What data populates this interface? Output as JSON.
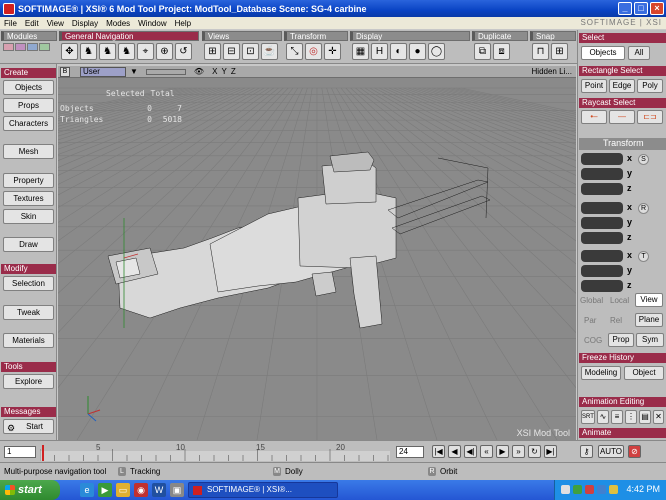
{
  "title": {
    "app": "SOFTIMAGE®",
    "text": "SOFTIMAGE® | XSI® 6 Mod Tool Project: ModTool_Database    Scene: SG-4 carbine",
    "brand": "SOFTIMAGE | XSI"
  },
  "menu": [
    "File",
    "Edit",
    "View",
    "Display",
    "Modes",
    "Window",
    "Help"
  ],
  "toolbar": {
    "modules": "Modules",
    "general_navigation": "General Navigation",
    "views": "Views",
    "transform": "Transform",
    "display": "Display",
    "duplicate": "Duplicate",
    "snap": "Snap",
    "select": "Select",
    "logo_text": "SOFTIMAGE | XSI"
  },
  "left_panel": {
    "create_header": "Create",
    "buttons_create": [
      "Objects",
      "Props",
      "Characters",
      "Mesh",
      "Property",
      "Textures",
      "Skin",
      "Draw"
    ],
    "modify_header": "Modify",
    "buttons_modify": [
      "Selection",
      "Tweak",
      "Materials"
    ],
    "tools_header": "Tools",
    "buttons_tools": [
      "Explore"
    ],
    "messages_header": "Messages",
    "start_label": "Start"
  },
  "viewport": {
    "letter": "B",
    "camera": "User",
    "xyz": "X Y Z",
    "hidden": "Hidden Li...",
    "stats_header": [
      "Selected",
      "Total"
    ],
    "stats": [
      {
        "label": "Objects",
        "selected": "0",
        "total": "7"
      },
      {
        "label": "Triangles",
        "selected": "0",
        "total": "5018"
      }
    ],
    "footer": "XSI Mod Tool"
  },
  "right_panel": {
    "select_header": "Select",
    "objects": "Objects",
    "all": "All",
    "rect_select": "Rectangle Select",
    "point": "Point",
    "edge": "Edge",
    "poly": "Poly",
    "raycast_select": "Raycast Select",
    "transform": "Transform",
    "axes": [
      "x",
      "y",
      "z",
      "x",
      "y",
      "z",
      "x",
      "y",
      "z"
    ],
    "spin_labels": [
      "S",
      "R",
      "T"
    ],
    "ref_modes": [
      "Global",
      "Local",
      "View"
    ],
    "ref_modes2": [
      "Par",
      "Rel",
      "Plane"
    ],
    "cog": "COG",
    "prop": "Prop",
    "sym": "Sym",
    "freeze_history": "Freeze History",
    "modeling": "Modeling",
    "object": "Object",
    "animation_editing": "Animation Editing",
    "animate": "Animate",
    "auto": "AUTO"
  },
  "timeline": {
    "start_frame": "1",
    "ticks": [
      "5",
      "10",
      "15",
      "20"
    ],
    "end_frame": "24",
    "current_frame": "1"
  },
  "status": {
    "message": "Multi-purpose navigation tool",
    "l_key": "L",
    "l_action": "Tracking",
    "m_key": "M",
    "m_action": "Dolly",
    "r_key": "R",
    "r_action": "Orbit"
  },
  "taskbar": {
    "start": "start",
    "task": "SOFTIMAGE® | XSI®...",
    "clock": "4:42 PM"
  },
  "colors": {
    "header_red": "#9a2c4a",
    "panel_gray": "#bdbdbd",
    "viewport_bg": "#8a8a8a",
    "wire": "#1c1c1c"
  }
}
